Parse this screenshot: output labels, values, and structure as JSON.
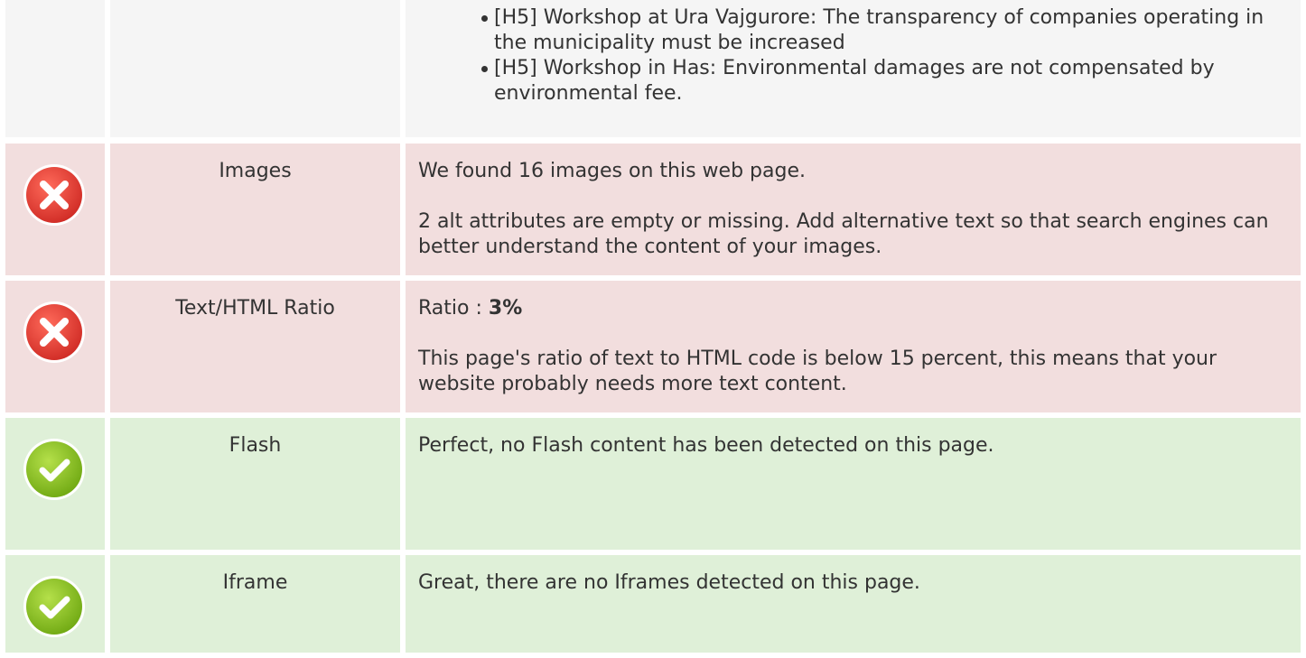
{
  "headings_tail": {
    "items": [
      "[H5] Workshop at Ura Vajgurore: The transparency of companies operating in the municipality must be increased",
      "[H5] Workshop in Has: Environmental damages are not compensated by environmental fee."
    ]
  },
  "rows": {
    "images": {
      "status": "error",
      "label": "Images",
      "text1": "We found 16 images on this web page.",
      "text2": "2 alt attributes are empty or missing. Add alternative text so that search engines can better understand the content of your images."
    },
    "ratio": {
      "status": "error",
      "label": "Text/HTML Ratio",
      "ratio_prefix": "Ratio : ",
      "ratio_value": "3%",
      "text2": "This page's ratio of text to HTML code is below 15 percent, this means that your website probably needs more text content."
    },
    "flash": {
      "status": "ok",
      "label": "Flash",
      "text1": "Perfect, no Flash content has been detected on this page."
    },
    "iframe": {
      "status": "ok",
      "label": "Iframe",
      "text1": "Great, there are no Iframes detected on this page."
    }
  },
  "colors": {
    "error_bg": "#f2dede",
    "ok_bg": "#dff0d8",
    "neutral_bg": "#f5f5f5",
    "error_icon": "#e8443f",
    "ok_icon": "#8cc21c"
  },
  "icons": {
    "error": "error-x-circle-icon",
    "ok": "check-circle-icon"
  }
}
